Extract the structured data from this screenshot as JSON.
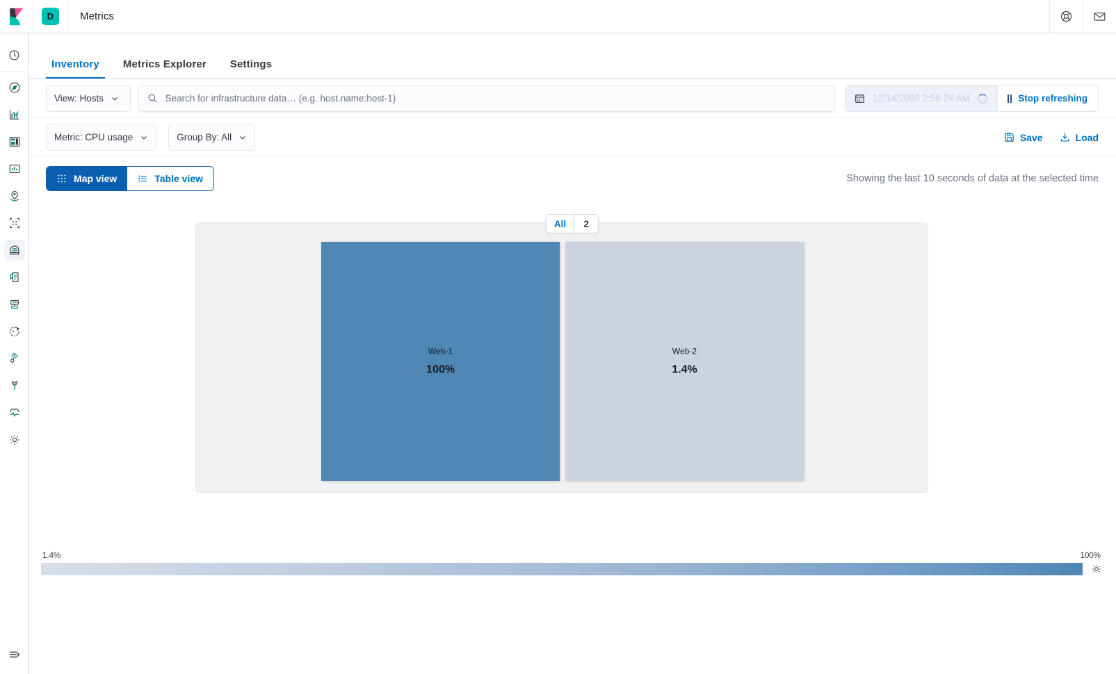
{
  "header": {
    "logo_name": "kibana-logo",
    "space_badge": "D",
    "app_title": "Metrics",
    "help_icon": "help-lifebuoy-icon",
    "mail_icon": "mail-envelope-icon"
  },
  "sidebar": {
    "items": [
      {
        "name": "recently-viewed",
        "icon": "clock-icon",
        "selected": false
      },
      {
        "name": "discover",
        "icon": "compass-icon",
        "selected": false
      },
      {
        "name": "visualize",
        "icon": "chart-icon",
        "selected": false
      },
      {
        "name": "dashboard",
        "icon": "dashboard-icon",
        "selected": false
      },
      {
        "name": "canvas",
        "icon": "canvas-icon",
        "selected": false
      },
      {
        "name": "maps",
        "icon": "map-pin-icon",
        "selected": false
      },
      {
        "name": "machine-learning",
        "icon": "ml-nodes-icon",
        "selected": false
      },
      {
        "name": "infrastructure",
        "icon": "infrastructure-icon",
        "selected": true
      },
      {
        "name": "logs",
        "icon": "logs-icon",
        "selected": false
      },
      {
        "name": "apm",
        "icon": "apm-icon",
        "selected": false
      },
      {
        "name": "uptime",
        "icon": "uptime-icon",
        "selected": false
      },
      {
        "name": "siem",
        "icon": "siem-icon",
        "selected": false
      },
      {
        "name": "dev-tools",
        "icon": "wrench-icon",
        "selected": false
      },
      {
        "name": "monitoring",
        "icon": "heartbeat-icon",
        "selected": false
      },
      {
        "name": "management",
        "icon": "gear-icon",
        "selected": false
      }
    ],
    "collapse_icon": "collapse-nav-icon"
  },
  "tabs": [
    {
      "label": "Inventory",
      "active": true
    },
    {
      "label": "Metrics Explorer",
      "active": false
    },
    {
      "label": "Settings",
      "active": false
    }
  ],
  "filters": {
    "view_select_label": "View: Hosts",
    "search_placeholder": "Search for infrastructure data… (e.g. host.name:host-1)",
    "search_value": "",
    "search_icon": "search-icon",
    "date_value": "12/14/2020 2:58:24 AM",
    "calendar_icon": "calendar-icon",
    "refresh_label": "Stop refreshing",
    "metric_label": "Metric: CPU usage",
    "group_by_label": "Group By: All",
    "save_label": "Save",
    "load_label": "Load",
    "save_icon": "save-disk-icon",
    "load_icon": "load-import-icon"
  },
  "toolbar": {
    "map_view_label": "Map view",
    "table_view_label": "Table view",
    "map_view_icon": "grid-icon",
    "table_view_icon": "list-icon",
    "showing_text": "Showing the last 10 seconds of data at the selected time"
  },
  "group_tabs": [
    {
      "label": "All",
      "active": true
    },
    {
      "label": "2",
      "active": false
    }
  ],
  "chart_data": {
    "type": "treemap",
    "title": "",
    "metric": "CPU usage",
    "unit": "%",
    "nodes": [
      {
        "name": "Web-1",
        "value": 100,
        "display": "100%",
        "color": "#4e86b4"
      },
      {
        "name": "Web-2",
        "value": 1.4,
        "display": "1.4%",
        "color": "#cbd3e1"
      }
    ],
    "legend": {
      "min_label": "1.4%",
      "max_label": "100%",
      "min_value": 1.4,
      "max_value": 100,
      "gradient_from": "#d7deea",
      "gradient_to": "#4e86b4"
    }
  },
  "legend": {
    "min_label": "1.4%",
    "max_label": "100%",
    "gear_icon": "legend-settings-gear-icon"
  }
}
